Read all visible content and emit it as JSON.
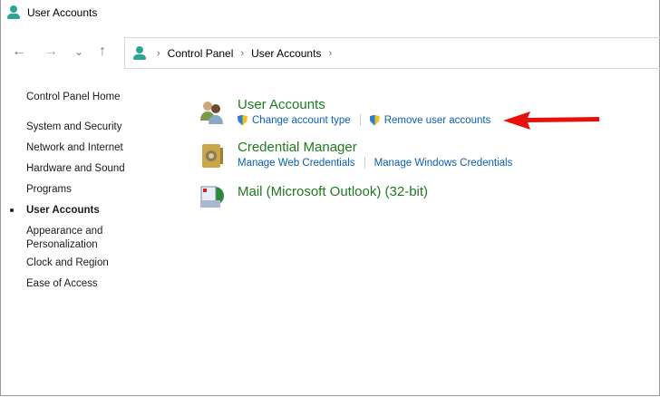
{
  "window": {
    "title": "User Accounts"
  },
  "nav": {
    "back": "←",
    "forward": "→",
    "recent": "⌄",
    "up": "↑"
  },
  "breadcrumb": [
    "Control Panel",
    "User Accounts"
  ],
  "sidebar": {
    "items": [
      {
        "label": "Control Panel Home"
      },
      {
        "label": "System and Security"
      },
      {
        "label": "Network and Internet"
      },
      {
        "label": "Hardware and Sound"
      },
      {
        "label": "Programs"
      },
      {
        "label": "User Accounts",
        "active": true
      },
      {
        "label": "Appearance and"
      },
      {
        "label": "Personalization"
      },
      {
        "label": "Clock and Region"
      },
      {
        "label": "Ease of Access"
      }
    ]
  },
  "categories": [
    {
      "title": "User Accounts",
      "links": [
        "Change account type",
        "Remove user accounts"
      ]
    },
    {
      "title": "Credential Manager",
      "links": [
        "Manage Web Credentials",
        "Manage Windows Credentials"
      ]
    },
    {
      "title": "Mail (Microsoft Outlook) (32-bit)"
    }
  ],
  "colors": {
    "accent": "#2aa594",
    "arrow": "#e8120c",
    "link": "#0b5fb5",
    "heading": "#1e7b1e"
  }
}
